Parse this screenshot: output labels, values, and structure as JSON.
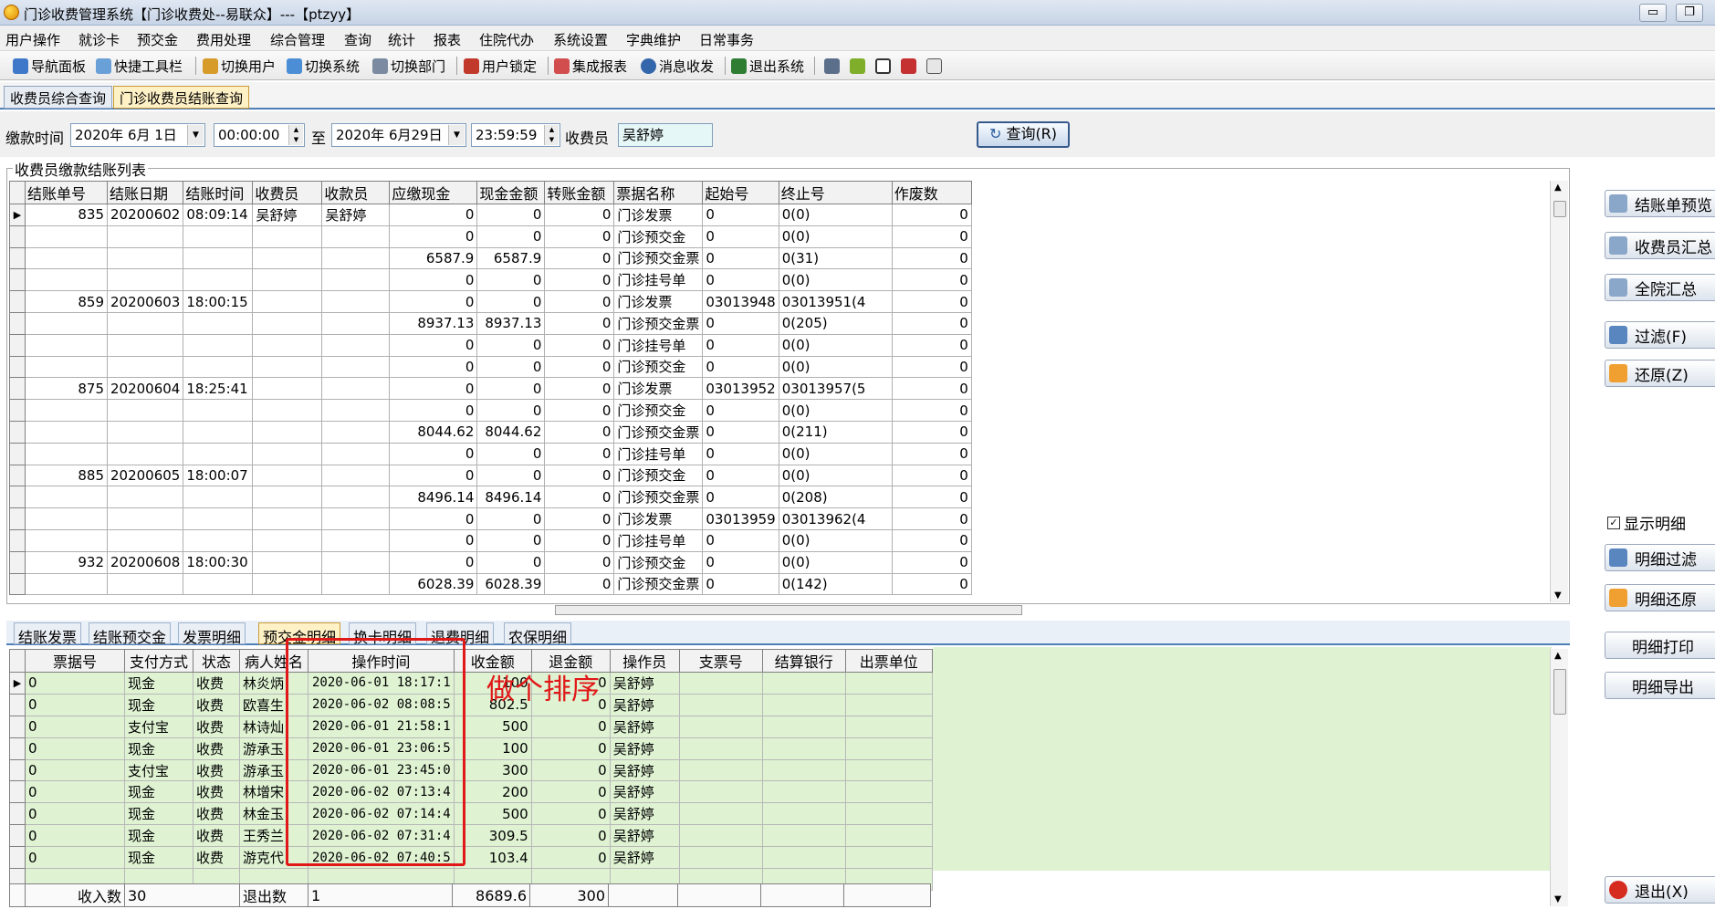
{
  "window": {
    "title": "门诊收费管理系统【门诊收费处--易联众】---【ptzyy】",
    "min_label": "▭",
    "restore_label": "❐"
  },
  "menu": [
    "用户操作",
    "就诊卡",
    "预交金",
    "费用处理",
    "综合管理",
    "查询",
    "统计",
    "报表",
    "住院代办",
    "系统设置",
    "字典维护",
    "日常事务"
  ],
  "toolbar": [
    {
      "label": "导航面板",
      "icon": "nav-panel-icon",
      "color": "#3f78c8"
    },
    {
      "label": "快捷工具栏",
      "icon": "quick-toolbar-icon",
      "color": "#6aa0d8"
    },
    {
      "label": "切换用户",
      "icon": "switch-user-icon",
      "color": "#d79b2a"
    },
    {
      "label": "切换系统",
      "icon": "switch-system-icon",
      "color": "#4b8ed6"
    },
    {
      "label": "切换部门",
      "icon": "switch-dept-icon",
      "color": "#7b8aa0"
    },
    {
      "label": "用户锁定",
      "icon": "user-lock-icon",
      "color": "#c0392b"
    },
    {
      "label": "集成报表",
      "icon": "report-icon",
      "color": "#d24d4d"
    },
    {
      "label": "消息收发",
      "icon": "message-icon",
      "color": "#3366aa"
    },
    {
      "label": "退出系统",
      "icon": "exit-system-icon",
      "color": "#2e7d32"
    }
  ],
  "toolbar_extra_icons": [
    "edit-icon",
    "scissors-icon",
    "checkbox-icon",
    "copy-icon",
    "calculator-icon"
  ],
  "top_tabs": [
    "收费员综合查询",
    "门诊收费员结账查询"
  ],
  "filter": {
    "time_label": "缴款时间",
    "start_date": "2020年 6月 1日",
    "start_time": "00:00:00",
    "to_label": "至",
    "end_date": "2020年 6月29日",
    "end_time": "23:59:59",
    "cashier_label": "收费员",
    "cashier_value": "吴舒婷",
    "query_button": "查询(R)"
  },
  "group_title": "收费员缴款结账列表",
  "grid1": {
    "columns": [
      "结账单号",
      "结账日期",
      "结账时间",
      "收费员",
      "收款员",
      "应缴现金",
      "现金金额",
      "转账金额",
      "票据名称",
      "起始号",
      "终止号",
      "作废数"
    ],
    "rows": [
      [
        "835",
        "20200602",
        "08:09:14",
        "吴舒婷",
        "吴舒婷",
        "0",
        "0",
        "0",
        "门诊发票",
        "0",
        "0(0)",
        "0"
      ],
      [
        "",
        "",
        "",
        "",
        "",
        "0",
        "0",
        "0",
        "门诊预交金",
        "0",
        "0(0)",
        "0"
      ],
      [
        "",
        "",
        "",
        "",
        "",
        "6587.9",
        "6587.9",
        "0",
        "门诊预交金票",
        "0",
        "0(31)",
        "0"
      ],
      [
        "",
        "",
        "",
        "",
        "",
        "0",
        "0",
        "0",
        "门诊挂号单",
        "0",
        "0(0)",
        "0"
      ],
      [
        "859",
        "20200603",
        "18:00:15",
        "",
        "",
        "0",
        "0",
        "0",
        "门诊发票",
        "03013948",
        "03013951(4",
        "0"
      ],
      [
        "",
        "",
        "",
        "",
        "",
        "8937.13",
        "8937.13",
        "0",
        "门诊预交金票",
        "0",
        "0(205)",
        "0"
      ],
      [
        "",
        "",
        "",
        "",
        "",
        "0",
        "0",
        "0",
        "门诊挂号单",
        "0",
        "0(0)",
        "0"
      ],
      [
        "",
        "",
        "",
        "",
        "",
        "0",
        "0",
        "0",
        "门诊预交金",
        "0",
        "0(0)",
        "0"
      ],
      [
        "875",
        "20200604",
        "18:25:41",
        "",
        "",
        "0",
        "0",
        "0",
        "门诊发票",
        "03013952",
        "03013957(5",
        "0"
      ],
      [
        "",
        "",
        "",
        "",
        "",
        "0",
        "0",
        "0",
        "门诊预交金",
        "0",
        "0(0)",
        "0"
      ],
      [
        "",
        "",
        "",
        "",
        "",
        "8044.62",
        "8044.62",
        "0",
        "门诊预交金票",
        "0",
        "0(211)",
        "0"
      ],
      [
        "",
        "",
        "",
        "",
        "",
        "0",
        "0",
        "0",
        "门诊挂号单",
        "0",
        "0(0)",
        "0"
      ],
      [
        "885",
        "20200605",
        "18:00:07",
        "",
        "",
        "0",
        "0",
        "0",
        "门诊预交金",
        "0",
        "0(0)",
        "0"
      ],
      [
        "",
        "",
        "",
        "",
        "",
        "8496.14",
        "8496.14",
        "0",
        "门诊预交金票",
        "0",
        "0(208)",
        "0"
      ],
      [
        "",
        "",
        "",
        "",
        "",
        "0",
        "0",
        "0",
        "门诊发票",
        "03013959",
        "03013962(4",
        "0"
      ],
      [
        "",
        "",
        "",
        "",
        "",
        "0",
        "0",
        "0",
        "门诊挂号单",
        "0",
        "0(0)",
        "0"
      ],
      [
        "932",
        "20200608",
        "18:00:30",
        "",
        "",
        "0",
        "0",
        "0",
        "门诊预交金",
        "0",
        "0(0)",
        "0"
      ],
      [
        "",
        "",
        "",
        "",
        "",
        "6028.39",
        "6028.39",
        "0",
        "门诊预交金票",
        "0",
        "0(142)",
        "0"
      ]
    ]
  },
  "bottom_tabs": [
    "结账发票",
    "结账预交金",
    "发票明细",
    "预交金明细",
    "换卡明细",
    "退费明细",
    "农保明细"
  ],
  "grid2": {
    "columns": [
      "票据号",
      "支付方式",
      "状态",
      "病人姓名",
      "操作时间",
      "收金额",
      "退金额",
      "操作员",
      "支票号",
      "结算银行",
      "出票单位"
    ],
    "rows": [
      [
        "0",
        "现金",
        "收费",
        "林炎炳",
        "2020-06-01 18:17:1",
        "100",
        "0",
        "吴舒婷",
        "",
        "",
        ""
      ],
      [
        "0",
        "现金",
        "收费",
        "欧喜生",
        "2020-06-02 08:08:5",
        "802.5",
        "0",
        "吴舒婷",
        "",
        "",
        ""
      ],
      [
        "0",
        "支付宝",
        "收费",
        "林诗灿",
        "2020-06-01 21:58:1",
        "500",
        "0",
        "吴舒婷",
        "",
        "",
        ""
      ],
      [
        "0",
        "现金",
        "收费",
        "游承玉",
        "2020-06-01 23:06:5",
        "100",
        "0",
        "吴舒婷",
        "",
        "",
        ""
      ],
      [
        "0",
        "支付宝",
        "收费",
        "游承玉",
        "2020-06-01 23:45:0",
        "300",
        "0",
        "吴舒婷",
        "",
        "",
        ""
      ],
      [
        "0",
        "现金",
        "收费",
        "林增宋",
        "2020-06-02 07:13:4",
        "200",
        "0",
        "吴舒婷",
        "",
        "",
        ""
      ],
      [
        "0",
        "现金",
        "收费",
        "林金玉",
        "2020-06-02 07:14:4",
        "500",
        "0",
        "吴舒婷",
        "",
        "",
        ""
      ],
      [
        "0",
        "现金",
        "收费",
        "王秀兰",
        "2020-06-02 07:31:4",
        "309.5",
        "0",
        "吴舒婷",
        "",
        "",
        ""
      ],
      [
        "0",
        "现金",
        "收费",
        "游克代",
        "2020-06-02 07:40:5",
        "103.4",
        "0",
        "吴舒婷",
        "",
        "",
        ""
      ]
    ],
    "footer": [
      "收入数",
      "30",
      "退出数",
      "1",
      "8689.6",
      "300"
    ]
  },
  "annotation": "做个排序",
  "side_buttons": [
    {
      "label": "结账单预览",
      "icon": "preview-icon"
    },
    {
      "label": "收费员汇总",
      "icon": "cashier-summary-icon"
    },
    {
      "label": "全院汇总",
      "icon": "hospital-summary-icon"
    },
    {
      "label": "过滤(F)",
      "icon": "filter-icon"
    },
    {
      "label": "还原(Z)",
      "icon": "restore-icon"
    }
  ],
  "show_detail_label": "显示明细",
  "side_buttons2": [
    {
      "label": "明细过滤",
      "icon": "detail-filter-icon"
    },
    {
      "label": "明细还原",
      "icon": "detail-restore-icon"
    },
    {
      "label": "明细打印",
      "icon": ""
    },
    {
      "label": "明细导出",
      "icon": ""
    }
  ],
  "exit_button": "退出(X)"
}
